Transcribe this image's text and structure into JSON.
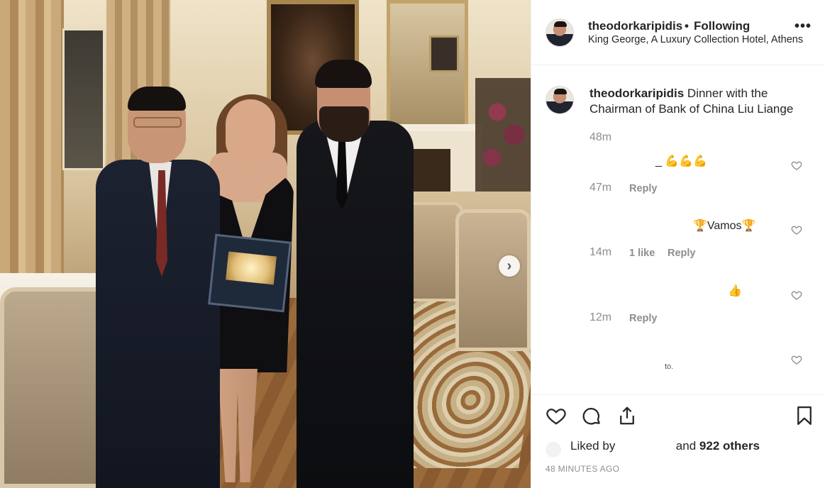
{
  "post": {
    "username": "theodorkaripidis",
    "dot": "•",
    "follow_status": "Following",
    "location": "King George, A Luxury Collection Hotel, Athens",
    "more_label": "•••",
    "next_label": "›"
  },
  "caption": {
    "username": "theodorkaripidis",
    "text": "Dinner with the Chairman of Bank of China Liu Liange",
    "time": "48m"
  },
  "comments": [
    {
      "text": "_ 💪💪💪",
      "time": "47m",
      "likes": "",
      "reply": "Reply"
    },
    {
      "text": "🏆Vamos🏆",
      "time": "14m",
      "likes": "1 like",
      "reply": "Reply"
    },
    {
      "text": "👍",
      "time": "12m",
      "likes": "",
      "reply": "Reply"
    },
    {
      "text": "to.",
      "time": "",
      "likes": "",
      "reply": ""
    }
  ],
  "actions": {
    "like_icon": "heart-icon",
    "comment_icon": "comment-bubble-icon",
    "share_icon": "share-icon",
    "save_icon": "bookmark-icon"
  },
  "likes_line": {
    "prefix": "Liked by",
    "suffix": "and",
    "count": "922 others"
  },
  "timestamp": "48 MINUTES AGO",
  "colors": {
    "text": "#262626",
    "muted": "#8e8e8e",
    "border": "#efefef"
  }
}
